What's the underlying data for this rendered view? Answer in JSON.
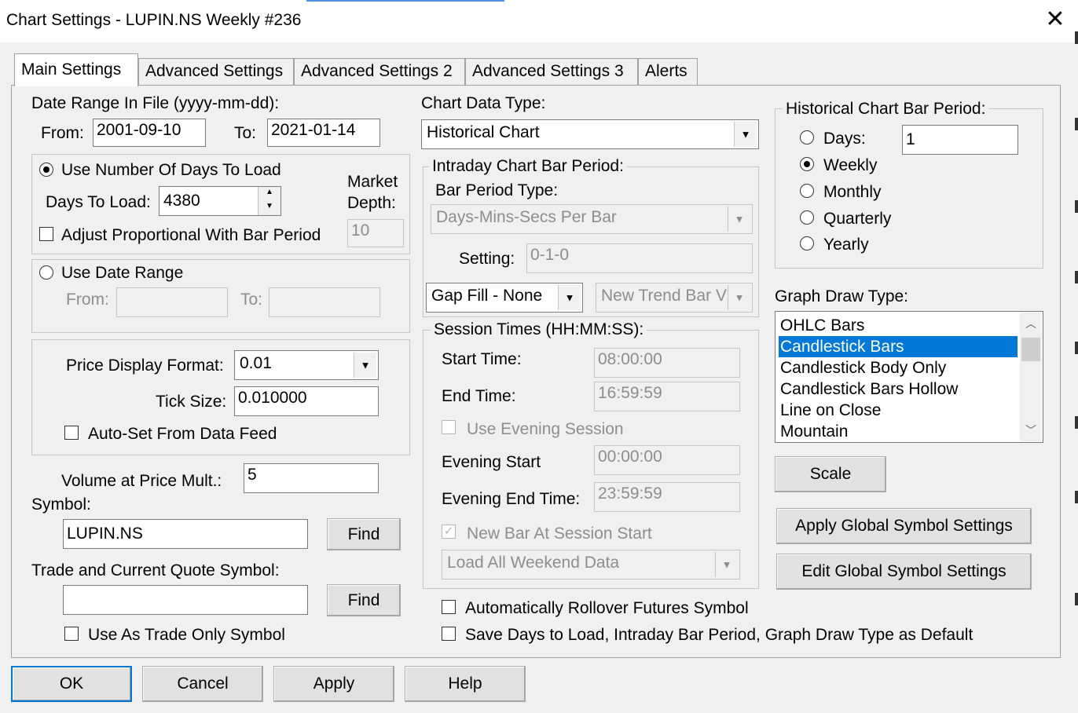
{
  "window": {
    "title": "Chart Settings - LUPIN.NS  Weekly  #236",
    "close_glyph": "✕"
  },
  "tabs": [
    {
      "label": "Main Settings",
      "active": true
    },
    {
      "label": "Advanced Settings",
      "active": false
    },
    {
      "label": "Advanced Settings 2",
      "active": false
    },
    {
      "label": "Advanced Settings 3",
      "active": false
    },
    {
      "label": "Alerts",
      "active": false
    }
  ],
  "date_range": {
    "label": "Date Range In File (yyyy-mm-dd):",
    "from_label": "From:",
    "from": "2001-09-10",
    "to_label": "To:",
    "to": "2021-01-14"
  },
  "days_group": {
    "use_days_label": "Use Number Of Days To Load",
    "days_to_load_label": "Days To Load:",
    "days_to_load": "4380",
    "market_depth_label_1": "Market",
    "market_depth_label_2": "Depth:",
    "market_depth": "10",
    "adjust_label": "Adjust Proportional With Bar Period"
  },
  "date_range_group": {
    "use_date_range_label": "Use Date Range",
    "from_label": "From:",
    "to_label": "To:",
    "from": "",
    "to": ""
  },
  "price_group": {
    "price_display_label": "Price Display Format:",
    "price_display": "0.01",
    "tick_size_label": "Tick Size:",
    "tick_size": "0.010000",
    "auto_set_label": "Auto-Set From Data Feed"
  },
  "volume": {
    "label": "Volume at Price Mult.:",
    "value": "5"
  },
  "symbol": {
    "label": "Symbol:",
    "value": "LUPIN.NS",
    "find": "Find"
  },
  "trade_symbol": {
    "label": "Trade and Current Quote Symbol:",
    "value": "",
    "find": "Find",
    "trade_only_label": "Use As Trade Only Symbol"
  },
  "chart_data_type": {
    "label": "Chart Data Type:",
    "value": "Historical Chart"
  },
  "intraday": {
    "legend": "Intraday Chart Bar Period:",
    "bar_period_type_label": "Bar Period Type:",
    "bar_period_type": "Days-Mins-Secs Per Bar",
    "setting_label": "Setting:",
    "setting": "0-1-0",
    "gap_fill": "Gap Fill - None",
    "new_trend": "New Trend Bar V"
  },
  "session": {
    "legend": "Session Times (HH:MM:SS):",
    "start_label": "Start Time:",
    "start": "08:00:00",
    "end_label": "End Time:",
    "end": "16:59:59",
    "use_evening_label": "Use Evening Session",
    "evening_start_label": "Evening Start",
    "evening_start": "00:00:00",
    "evening_end_label": "Evening End Time:",
    "evening_end": "23:59:59",
    "new_bar_label": "New Bar At Session Start",
    "weekend": "Load All Weekend Data"
  },
  "rollover_label": "Automatically Rollover Futures Symbol",
  "save_default_label": "Save Days to Load, Intraday Bar Period, Graph Draw Type as Default",
  "historical": {
    "legend": "Historical Chart Bar Period:",
    "days_label": "Days:",
    "days_value": "1",
    "weekly_label": "Weekly",
    "monthly_label": "Monthly",
    "quarterly_label": "Quarterly",
    "yearly_label": "Yearly"
  },
  "graph_draw": {
    "label": "Graph Draw Type:",
    "items": [
      "OHLC Bars",
      "Candlestick Bars",
      "Candlestick Body Only",
      "Candlestick Bars Hollow",
      "Line on Close",
      "Mountain"
    ],
    "selected": "Candlestick Bars"
  },
  "buttons": {
    "scale": "Scale",
    "apply_global": "Apply Global Symbol Settings",
    "edit_global": "Edit Global Symbol Settings",
    "ok": "OK",
    "cancel": "Cancel",
    "apply": "Apply",
    "help": "Help"
  },
  "glyphs": {
    "check": "✓",
    "down": "▼",
    "up_small": "▲",
    "down_small": "▼",
    "scroll_up": "︿",
    "scroll_down": "﹀"
  }
}
